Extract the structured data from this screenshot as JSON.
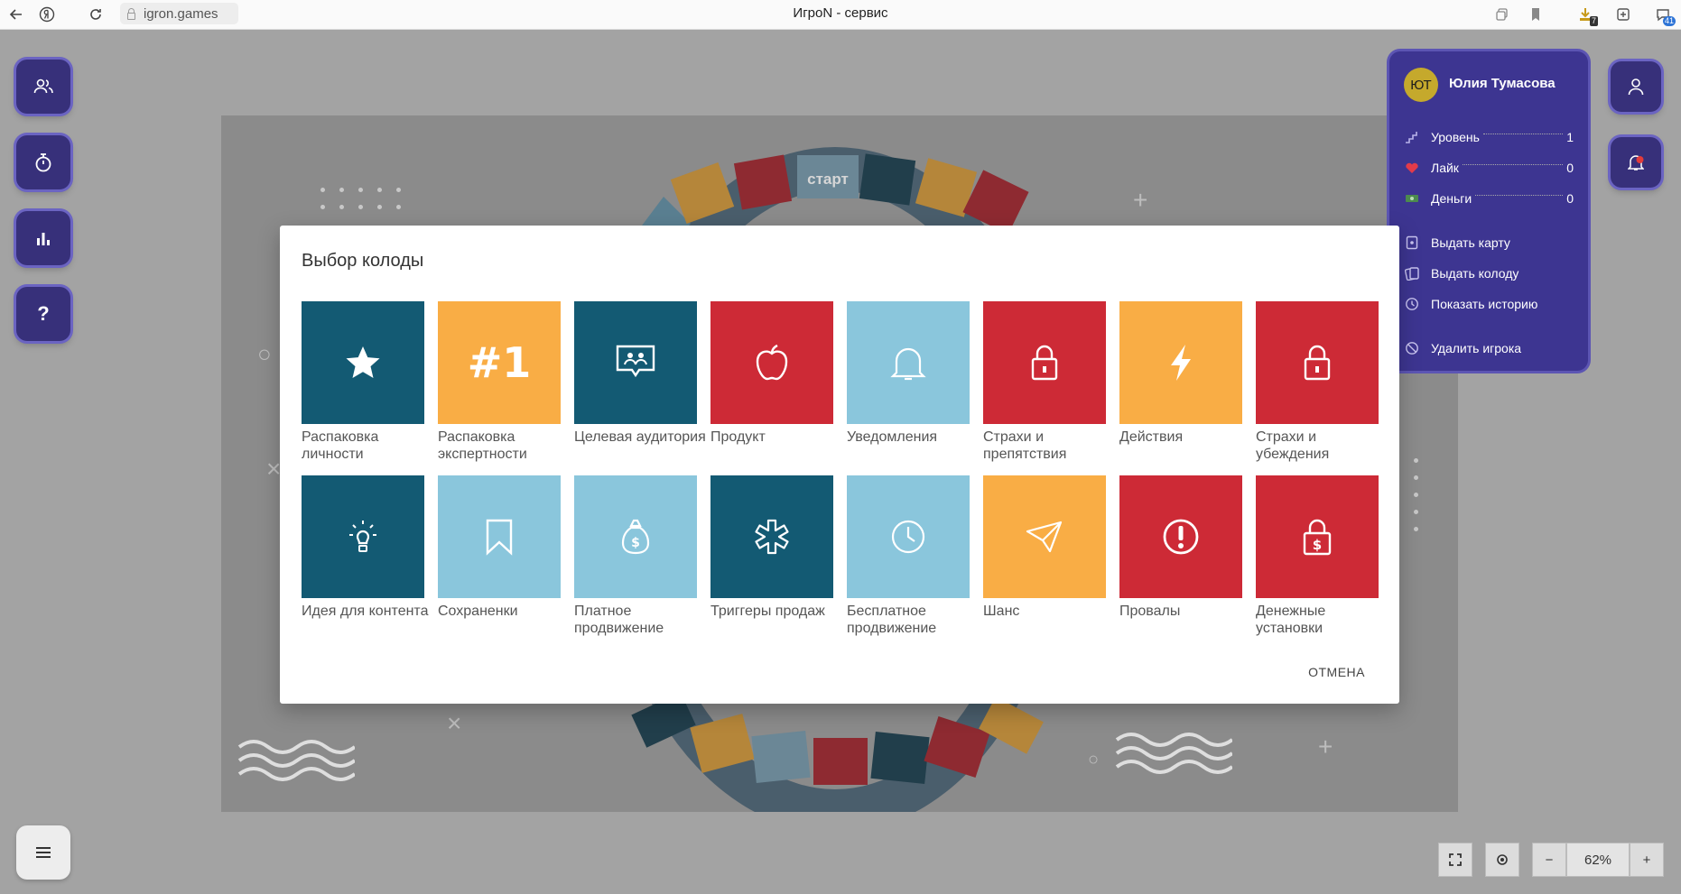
{
  "browser": {
    "url": "igron.games",
    "window_title": "ИгроN - сервис",
    "extension_badge_1": "7",
    "extension_badge_2": "41"
  },
  "player": {
    "initials": "ЮТ",
    "name": "Юлия Тумасова",
    "stats": [
      {
        "label": "Уровень",
        "value": "1",
        "icon": "level-icon"
      },
      {
        "label": "Лайк",
        "value": "0",
        "icon": "heart-icon"
      },
      {
        "label": "Деньги",
        "value": "0",
        "icon": "money-icon"
      }
    ],
    "actions": [
      {
        "label": "Выдать карту",
        "icon": "card-icon"
      },
      {
        "label": "Выдать колоду",
        "icon": "deck-icon"
      },
      {
        "label": "Показать историю",
        "icon": "history-icon"
      },
      {
        "label": "Удалить игрока",
        "icon": "ban-icon"
      }
    ]
  },
  "board": {
    "start_label": "старт"
  },
  "modal": {
    "title": "Выбор колоды",
    "cancel_label": "ОТМЕНА",
    "decks": [
      {
        "label": "Распаковка личности",
        "icon": "star-icon",
        "color": "#135a73"
      },
      {
        "label": "Распаковка экспертности",
        "icon": "number-one-icon",
        "glyph": "#1",
        "color": "#f9ad45"
      },
      {
        "label": "Целевая аудитория",
        "icon": "audience-chat-icon",
        "color": "#135a73"
      },
      {
        "label": "Продукт",
        "icon": "apple-icon",
        "color": "#cd2a36"
      },
      {
        "label": "Уведомления",
        "icon": "bell-icon",
        "color": "#8ac6dc"
      },
      {
        "label": "Страхи и препятствия",
        "icon": "lock-icon",
        "color": "#cd2a36"
      },
      {
        "label": "Действия",
        "icon": "lightning-icon",
        "color": "#f9ad45"
      },
      {
        "label": "Страхи и убеждения",
        "icon": "lock-icon",
        "color": "#cd2a36"
      },
      {
        "label": "Идея для контента",
        "icon": "lightbulb-icon",
        "color": "#135a73"
      },
      {
        "label": "Сохраненки",
        "icon": "bookmark-icon",
        "color": "#8ac6dc"
      },
      {
        "label": "Платное продвижение",
        "icon": "money-bag-icon",
        "color": "#8ac6dc"
      },
      {
        "label": "Триггеры продаж",
        "icon": "asterisk-icon",
        "color": "#135a73"
      },
      {
        "label": "Бесплатное продвижение",
        "icon": "clock-icon",
        "color": "#8ac6dc"
      },
      {
        "label": "Шанс",
        "icon": "paper-plane-icon",
        "color": "#f9ad45"
      },
      {
        "label": "Провалы",
        "icon": "exclamation-icon",
        "color": "#cd2a36"
      },
      {
        "label": "Денежные установки",
        "icon": "money-lock-icon",
        "color": "#cd2a36"
      }
    ]
  },
  "zoom": {
    "level": "62%",
    "minus": "−",
    "plus": "+"
  }
}
